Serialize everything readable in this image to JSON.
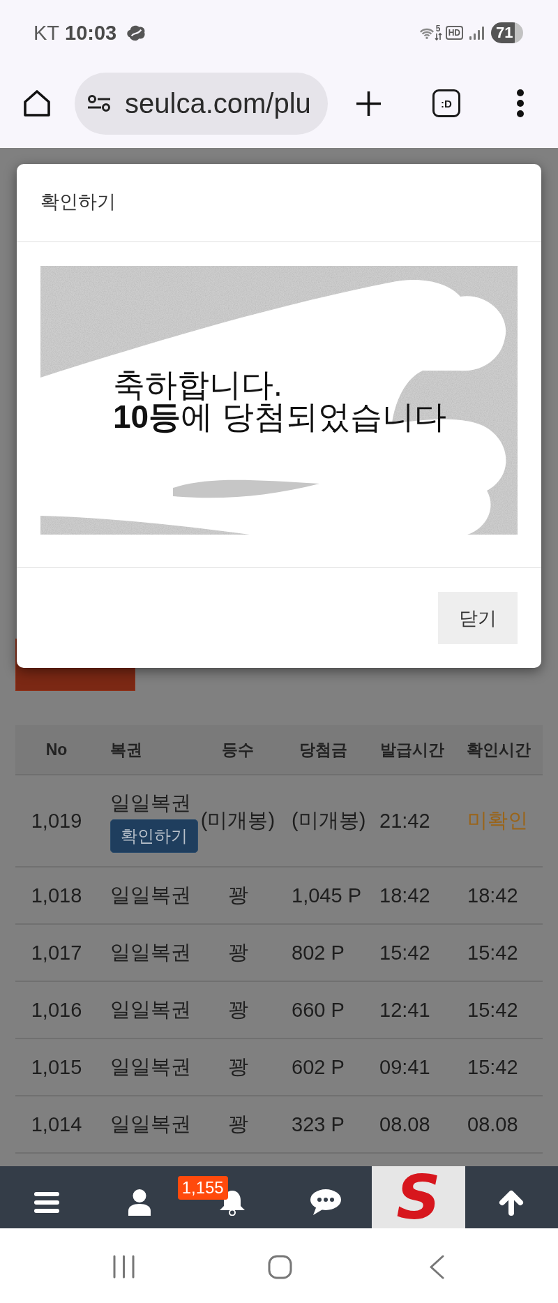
{
  "status_bar": {
    "carrier": "KT",
    "time": "10:03",
    "network_label": "5",
    "hd_label": "HD",
    "battery": "71"
  },
  "browser": {
    "url": "seulca.com/plu",
    "tab_label": ":D"
  },
  "page": {
    "table": {
      "columns": [
        "No",
        "복권",
        "등수",
        "당첨금",
        "발급시간",
        "확인시간"
      ],
      "rows": [
        {
          "no": "1,019",
          "ticket": "일일복권",
          "action": "확인하기",
          "rank": "(미개봉)",
          "prize": "(미개봉)",
          "issued": "21:42",
          "checked": "미확인",
          "confirmed": false
        },
        {
          "no": "1,018",
          "ticket": "일일복권",
          "rank": "꽝",
          "prize": "1,045 P",
          "issued": "18:42",
          "checked": "18:42",
          "confirmed": true
        },
        {
          "no": "1,017",
          "ticket": "일일복권",
          "rank": "꽝",
          "prize": "802 P",
          "issued": "15:42",
          "checked": "15:42",
          "confirmed": true
        },
        {
          "no": "1,016",
          "ticket": "일일복권",
          "rank": "꽝",
          "prize": "660 P",
          "issued": "12:41",
          "checked": "15:42",
          "confirmed": true
        },
        {
          "no": "1,015",
          "ticket": "일일복권",
          "rank": "꽝",
          "prize": "602 P",
          "issued": "09:41",
          "checked": "15:42",
          "confirmed": true
        },
        {
          "no": "1,014",
          "ticket": "일일복권",
          "rank": "꽝",
          "prize": "323 P",
          "issued": "08.08",
          "checked": "08.08",
          "confirmed": true
        }
      ]
    }
  },
  "modal": {
    "title": "확인하기",
    "message_lines": [
      "축하합니다.",
      "**10등**에 당첨되었습니다"
    ],
    "buttons": [
      "닫기"
    ]
  },
  "bottom_nav": {
    "items": [
      {
        "kind": "menu"
      },
      {
        "kind": "user"
      },
      {
        "kind": "bell",
        "badge": "1,155"
      },
      {
        "kind": "chat"
      },
      {
        "kind": "logo",
        "text": "S"
      },
      {
        "kind": "top"
      }
    ]
  }
}
